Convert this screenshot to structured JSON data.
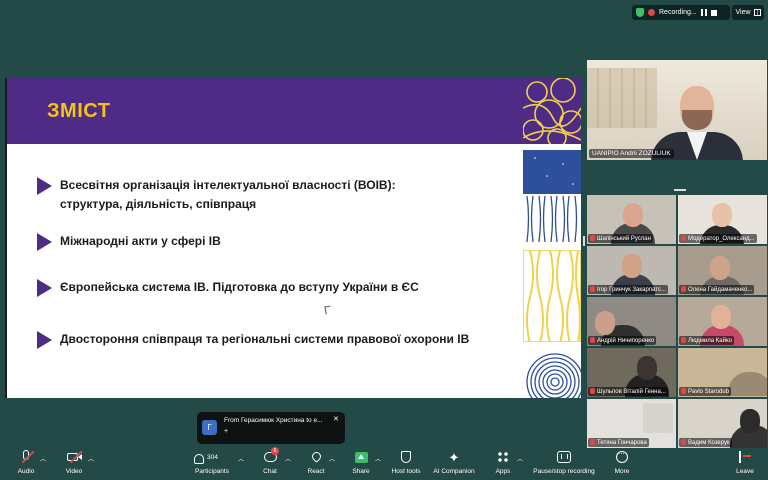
{
  "top_bar": {
    "recording_label": "Recording...",
    "view_label": "View"
  },
  "slide": {
    "title": "ЗМІСТ",
    "bullets": [
      "Всесвітня організація інтелектуальної власності (ВОІВ): структура, діяльність, співпраця",
      "Міжнародні акти у сфері ІВ",
      "Європейська система ІВ. Підготовка до вступу України в ЄС",
      "Двостороння співпраця та регіональні системи правової охорони ІВ"
    ],
    "colors": {
      "header": "#4e2b85",
      "title": "#f4c21a",
      "blue_pattern": "#2d4f9c",
      "yellow_pattern": "#f2d14a"
    }
  },
  "speaker": {
    "name": "UANIPIO Andrii ZOZULIUK"
  },
  "participants": [
    {
      "name": "Шапінський Руслан"
    },
    {
      "name": "Модератор_Олександ..."
    },
    {
      "name": "Ігор Гринчук Закарпатс..."
    },
    {
      "name": "Олена Гайдамаченко..."
    },
    {
      "name": "Андрій Ничипоренко"
    },
    {
      "name": "Людмила Кайко"
    },
    {
      "name": "Шульпов Віталій Генна..."
    },
    {
      "name": "Pavlo Starodub"
    },
    {
      "name": "Тетяна Гончарова"
    },
    {
      "name": "Вадим Козерук"
    }
  ],
  "chat_toast": {
    "avatar_letter": "Г",
    "title": "From Герасимюк Христина to e...",
    "body": "+"
  },
  "toolbar": {
    "audio": "Audio",
    "video": "Video",
    "participants": "Participants",
    "participant_count": "304",
    "chat": "Chat",
    "chat_badge": "6",
    "react": "React",
    "share": "Share",
    "host_tools": "Host tools",
    "ai_companion": "AI Companion",
    "apps": "Apps",
    "pause_stop_recording": "Pause/stop recording",
    "more": "More",
    "leave": "Leave"
  }
}
